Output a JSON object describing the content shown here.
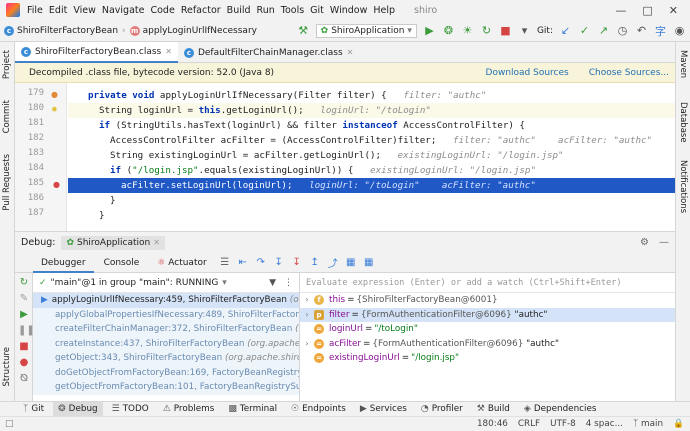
{
  "menubar": {
    "items": [
      "File",
      "Edit",
      "View",
      "Navigate",
      "Code",
      "Refactor",
      "Build",
      "Run",
      "Tools",
      "Git",
      "Window",
      "Help"
    ],
    "window_title": "shiro"
  },
  "navbar": {
    "crumb_class": "ShiroFilterFactoryBean",
    "crumb_method": "applyLoginUrlIfNecessary",
    "run_config": "ShiroApplication",
    "git_label": "Git:"
  },
  "tabs": [
    {
      "label": "ShiroFilterFactoryBean.class",
      "active": true
    },
    {
      "label": "DefaultFilterChainManager.class",
      "active": false
    }
  ],
  "left_strip": [
    "Project",
    "Commit",
    "Pull Requests",
    "Structure"
  ],
  "right_strip": [
    "Maven",
    "Database",
    "Notifications"
  ],
  "banner": {
    "text": "Decompiled .class file, bytecode version: 52.0 (Java 8)",
    "download": "Download Sources",
    "choose": "Choose Sources..."
  },
  "editor": {
    "line_numbers": [
      "179",
      "180",
      "181",
      "182",
      "183",
      "184",
      "185",
      "186",
      "187"
    ],
    "lines": [
      {
        "indent": 2,
        "segments": [
          {
            "t": "private void ",
            "c": "kw"
          },
          {
            "t": "applyLoginUrlIfNecessary(Filter filter) {",
            "c": ""
          },
          {
            "t": "   filter: \"authc\"",
            "c": "hint"
          }
        ]
      },
      {
        "indent": 3,
        "segments": [
          {
            "t": "String loginUrl = ",
            "c": ""
          },
          {
            "t": "this",
            "c": "kw"
          },
          {
            "t": ".getLoginUrl();",
            "c": ""
          },
          {
            "t": "   loginUrl: \"/toLogin\"",
            "c": "hint"
          }
        ]
      },
      {
        "indent": 3,
        "segments": [
          {
            "t": "if ",
            "c": "kw"
          },
          {
            "t": "(StringUtils.hasText(loginUrl) && filter ",
            "c": ""
          },
          {
            "t": "instanceof ",
            "c": "kw"
          },
          {
            "t": "AccessControlFilter) {",
            "c": ""
          }
        ]
      },
      {
        "indent": 4,
        "segments": [
          {
            "t": "AccessControlFilter acFilter = (AccessControlFilter)filter;",
            "c": ""
          },
          {
            "t": "   filter: \"authc\"    acFilter: \"authc\"",
            "c": "hint"
          }
        ]
      },
      {
        "indent": 4,
        "segments": [
          {
            "t": "String existingLoginUrl = acFilter.getLoginUrl();",
            "c": ""
          },
          {
            "t": "   existingLoginUrl: \"/login.jsp\"",
            "c": "hint"
          }
        ]
      },
      {
        "indent": 4,
        "segments": [
          {
            "t": "if ",
            "c": "kw"
          },
          {
            "t": "(",
            "c": ""
          },
          {
            "t": "\"/login.jsp\"",
            "c": "str"
          },
          {
            "t": ".equals(existingLoginUrl)) {",
            "c": ""
          },
          {
            "t": "   existingLoginUrl: \"/login.jsp\"",
            "c": "hint"
          }
        ]
      },
      {
        "indent": 5,
        "segments": [
          {
            "t": "acFilter.setLoginUrl(loginUrl);",
            "c": ""
          },
          {
            "t": "   loginUrl: \"/toLogin\"    acFilter: \"authc\"",
            "c": "hint"
          }
        ]
      },
      {
        "indent": 4,
        "segments": [
          {
            "t": "}",
            "c": ""
          }
        ]
      },
      {
        "indent": 3,
        "segments": [
          {
            "t": "}",
            "c": ""
          }
        ]
      }
    ]
  },
  "debug": {
    "title": "Debug:",
    "session": "ShiroApplication",
    "tab_debugger": "Debugger",
    "tab_console": "Console",
    "tab_actuator": "Actuator",
    "thread": "\"main\"@1 in group \"main\": RUNNING",
    "eval_placeholder": "Evaluate expression (Enter) or add a watch (Ctrl+Shift+Enter)",
    "frames": [
      {
        "method": "applyLoginUrlIfNecessary:459, ShiroFilterFactoryBean",
        "cls": "(org.apache"
      },
      {
        "method": "applyGlobalPropertiesIfNecessary:489, ShiroFilterFactoryBean",
        "cls": "(org.a"
      },
      {
        "method": "createFilterChainManager:372, ShiroFilterFactoryBean",
        "cls": "(org.apa"
      },
      {
        "method": "createInstance:437, ShiroFilterFactoryBean",
        "cls": "(org.apache.shiro.s"
      },
      {
        "method": "getObject:343, ShiroFilterFactoryBean",
        "cls": "(org.apache.shiro.spring.w"
      },
      {
        "method": "doGetObjectFromFactoryBean:169, FactoryBeanRegistrySupport",
        "cls": "(o"
      },
      {
        "method": "getObjectFromFactoryBean:101, FactoryBeanRegistrySupport",
        "cls": "(org."
      }
    ],
    "variables": [
      {
        "name": "this",
        "value": "{ShiroFilterFactoryBean@6001}",
        "str": "",
        "icon": "field",
        "expand": true,
        "selected": false
      },
      {
        "name": "filter",
        "value": "{FormAuthenticationFilter@6096}",
        "str": "\"authc\"",
        "icon": "param",
        "expand": true,
        "selected": true
      },
      {
        "name": "loginUrl",
        "value": "",
        "str": "\"/toLogin\"",
        "icon": "local",
        "expand": false,
        "selected": false
      },
      {
        "name": "acFilter",
        "value": "{FormAuthenticationFilter@6096}",
        "str": "\"authc\"",
        "icon": "local",
        "expand": true,
        "selected": false
      },
      {
        "name": "existingLoginUrl",
        "value": "",
        "str": "\"/login.jsp\"",
        "icon": "local",
        "expand": false,
        "selected": false
      }
    ]
  },
  "tool_tabs": [
    "Git",
    "Debug",
    "TODO",
    "Problems",
    "Terminal",
    "Endpoints",
    "Services",
    "Profiler",
    "Build",
    "Dependencies"
  ],
  "status": {
    "position": "180:46",
    "line_sep": "CRLF",
    "encoding": "UTF-8",
    "indent": "4 spac...",
    "branch": "main"
  }
}
